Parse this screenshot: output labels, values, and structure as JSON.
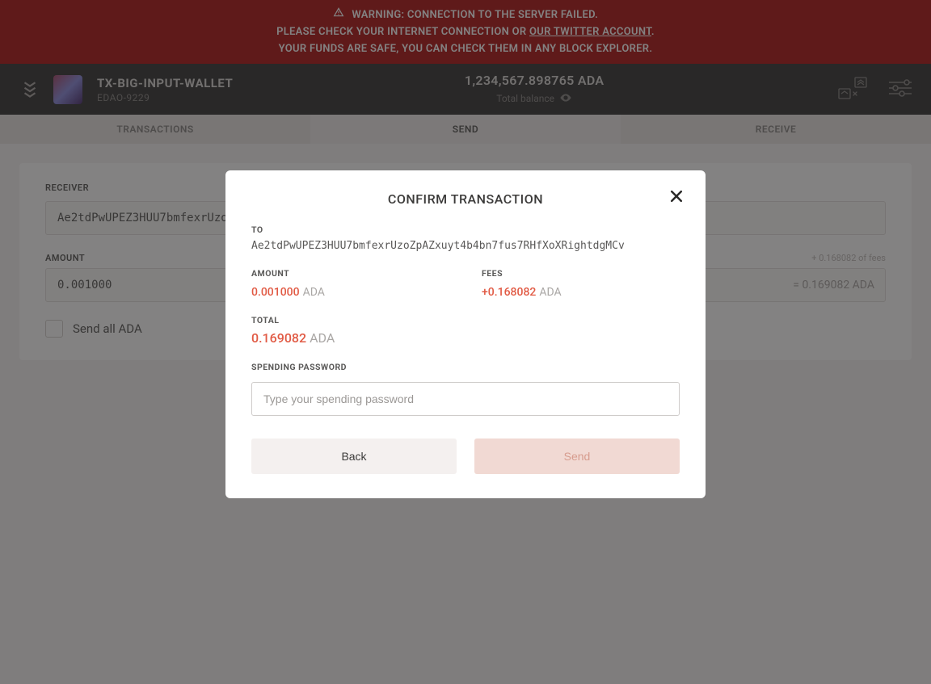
{
  "warning": {
    "line1": "WARNING: CONNECTION TO THE SERVER FAILED.",
    "line2_prefix": "PLEASE CHECK YOUR INTERNET CONNECTION OR ",
    "line2_link": "OUR TWITTER ACCOUNT",
    "line2_suffix": ".",
    "line3": "YOUR FUNDS ARE SAFE, YOU CAN CHECK THEM IN ANY BLOCK EXPLORER."
  },
  "header": {
    "wallet_name": "TX-BIG-INPUT-WALLET",
    "wallet_id": "EDAO-9229",
    "balance": "1,234,567.898765 ADA",
    "balance_label": "Total balance"
  },
  "tabs": {
    "transactions": "TRANSACTIONS",
    "send": "SEND",
    "receive": "RECEIVE"
  },
  "form": {
    "receiver_label": "RECEIVER",
    "receiver_value": "Ae2tdPwUPEZ3HUU7bmfexrUzo",
    "amount_label": "AMOUNT",
    "amount_value": "0.001000",
    "fees_hint": "+ 0.168082 of fees",
    "equals": "= 0.169082 ADA",
    "send_all": "Send all ADA"
  },
  "modal": {
    "title": "CONFIRM TRANSACTION",
    "to_label": "TO",
    "to_value": "Ae2tdPwUPEZ3HUU7bmfexrUzoZpAZxuyt4b4bn7fus7RHfXoXRightdgMCv",
    "amount_label": "AMOUNT",
    "amount_value": "0.001000",
    "amount_unit": "ADA",
    "fees_label": "FEES",
    "fees_value": "+0.168082",
    "fees_unit": "ADA",
    "total_label": "TOTAL",
    "total_value": "0.169082",
    "total_unit": "ADA",
    "password_label": "SPENDING PASSWORD",
    "password_placeholder": "Type your spending password",
    "back": "Back",
    "send": "Send"
  }
}
